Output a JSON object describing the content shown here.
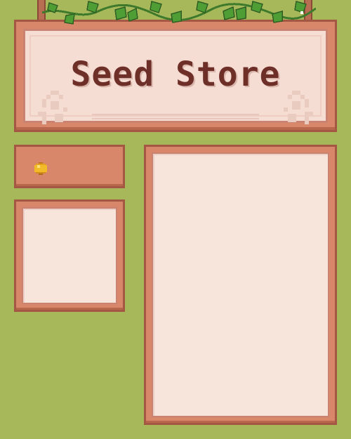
{
  "sign": {
    "title": "Seed Store"
  },
  "money": {
    "icon": "gold-coin-icon",
    "value": ""
  },
  "colors": {
    "background": "#a6b85a",
    "panel_frame": "#d9876b",
    "panel_fill": "#f7e4db",
    "title_text": "#6e2f29"
  }
}
